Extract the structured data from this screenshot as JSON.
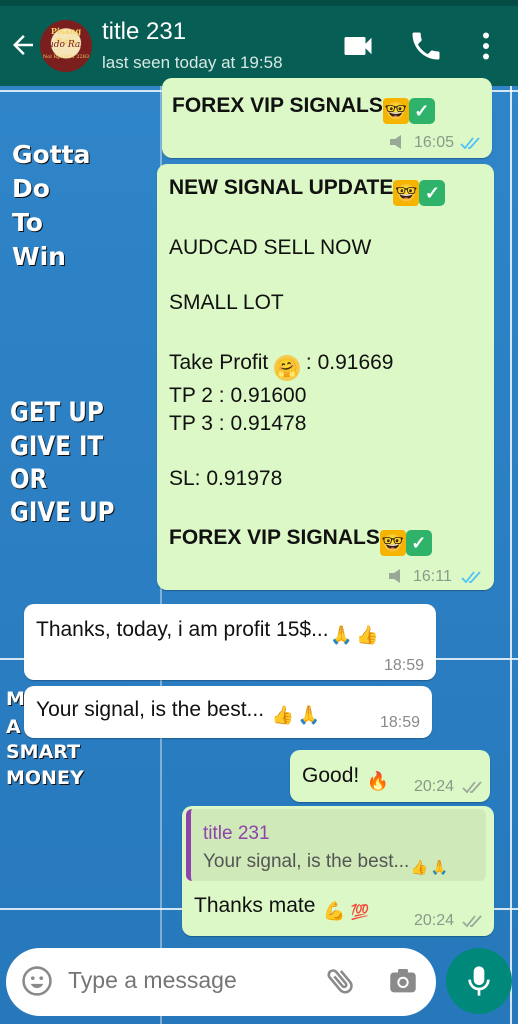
{
  "header": {
    "title": "title 231",
    "status": "last seen today at 19:58",
    "avatar_text": [
      "Pisang Raja",
      "Sudo Rasa",
      "Nol Rp 0821 2283"
    ],
    "icons": [
      "back-arrow-icon",
      "video-call-icon",
      "phone-icon",
      "more-vert-icon"
    ],
    "color": "#075e54"
  },
  "wallpaper": {
    "lines": [
      "Gotta",
      "Do",
      "To",
      "Win"
    ],
    "lines2": [
      "GET UP",
      "GIVE IT",
      "OR",
      "GIVE UP"
    ],
    "lines3": [
      "M",
      "A",
      "SMART",
      "MONEY"
    ]
  },
  "messages": {
    "m1": {
      "line": "FOREX VIP SIGNALS",
      "time": "16:05"
    },
    "m2": {
      "header": "NEW SIGNAL UPDATE",
      "pair": "AUDCAD SELL NOW",
      "lot": "SMALL LOT",
      "tp1_label": "Take Profit",
      "tp1_value": ": 0.91669",
      "tp2": "TP 2 : 0.91600",
      "tp3": "TP 3 : 0.91478",
      "sl": "SL: 0.91978",
      "footer": "FOREX VIP SIGNALS",
      "time": "16:11"
    },
    "m3": {
      "text": "Thanks, today, i am profit 15$...",
      "time": "18:59"
    },
    "m4": {
      "text": "Your signal, is the best...",
      "time": "18:59"
    },
    "m5": {
      "text": "Good!",
      "time": "20:24"
    },
    "m6": {
      "quote_author": "title 231",
      "quote_text": "Your signal, is the best...",
      "text": "Thanks mate",
      "time": "20:24"
    }
  },
  "composer": {
    "placeholder": "Type a message",
    "icons": [
      "emoji-icon",
      "attach-icon",
      "camera-icon",
      "mic-icon"
    ]
  },
  "colors": {
    "out_bubble": "#dcf8c6",
    "in_bubble": "#ffffff",
    "tick_read": "#4fc3f7",
    "mic": "#00897b"
  }
}
